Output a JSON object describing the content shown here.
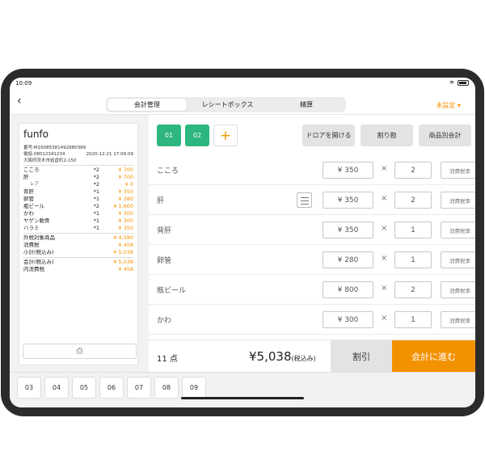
{
  "status": {
    "time": "10:09"
  },
  "header": {
    "back": "‹",
    "segments": [
      "会計管理",
      "レシートボックス",
      "精算"
    ],
    "unset": "未設定 ▾"
  },
  "receipt": {
    "brand": "funfo",
    "number": "番号:M160853814929803​89",
    "phone": "電話:08012341234",
    "datetime": "2020-12-21 17:09:09",
    "address": "大阪府茨木市岩倉町2-150",
    "items": [
      {
        "n": "こころ",
        "q": "*2",
        "p": "¥ 700"
      },
      {
        "n": "肝",
        "q": "*2",
        "p": "¥ 700"
      },
      {
        "n": "レア",
        "q": "*2",
        "p": "¥ 0"
      },
      {
        "n": "背肝",
        "q": "*1",
        "p": "¥ 350"
      },
      {
        "n": "卵管",
        "q": "*1",
        "p": "¥ 280"
      },
      {
        "n": "瓶ビール",
        "q": "*2",
        "p": "¥ 1,600"
      },
      {
        "n": "かわ",
        "q": "*1",
        "p": "¥ 300"
      },
      {
        "n": "ヤゲン軟骨",
        "q": "*1",
        "p": "¥ 300"
      },
      {
        "n": "ハラミ",
        "q": "*1",
        "p": "¥ 350"
      }
    ],
    "totals": [
      {
        "n": "外税対象商品",
        "p": "¥ 4,580"
      },
      {
        "n": "消費税",
        "p": "¥ 458"
      },
      {
        "n": "小計(税込み)",
        "p": "¥ 5,038"
      },
      {
        "n": "会計(税込み)",
        "p": "¥ 5,038"
      },
      {
        "n": "内消費税",
        "p": "¥ 458"
      }
    ]
  },
  "tabs": {
    "t1": "01",
    "t2": "02",
    "add": "+"
  },
  "toolbar": {
    "drawer": "ドロアを開ける",
    "split": "割り勘",
    "byitem": "商品別会計"
  },
  "rows": [
    {
      "name": "こころ",
      "price": "¥ 350",
      "x": "×",
      "qty": "2",
      "tax": "消費税率"
    },
    {
      "name": "肝",
      "price": "¥ 350",
      "x": "×",
      "qty": "2",
      "tax": "消費税率"
    },
    {
      "name": "背肝",
      "price": "¥ 350",
      "x": "×",
      "qty": "1",
      "tax": "消費税率"
    },
    {
      "name": "卵管",
      "price": "¥ 280",
      "x": "×",
      "qty": "1",
      "tax": "消費税率"
    },
    {
      "name": "瓶ビール",
      "price": "¥ 800",
      "x": "×",
      "qty": "2",
      "tax": "消費税率"
    },
    {
      "name": "かわ",
      "price": "¥ 300",
      "x": "×",
      "qty": "1",
      "tax": "消費税率"
    }
  ],
  "footer": {
    "count": "11 点",
    "total": "¥5,038",
    "taxnote": "(税込み)",
    "discount": "割引",
    "proceed": "会計に進む"
  },
  "bottom_tabs": [
    "03",
    "04",
    "05",
    "06",
    "07",
    "08",
    "09"
  ]
}
